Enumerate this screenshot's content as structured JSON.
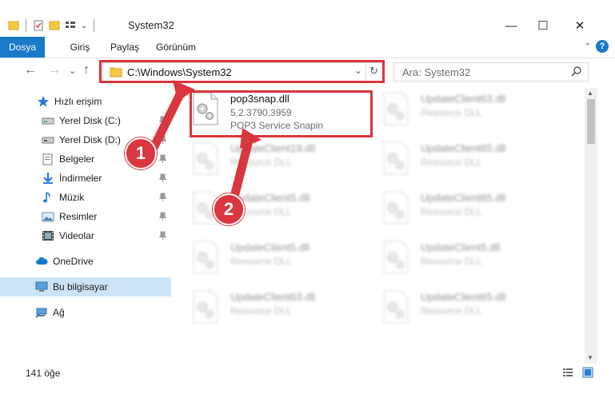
{
  "window": {
    "title": "System32",
    "minimize": "—",
    "maximize": "☐",
    "close": "✕"
  },
  "ribbon": {
    "tabs": [
      "Dosya",
      "Giriş",
      "Paylaş",
      "Görünüm"
    ],
    "collapse": "⌃",
    "help": "?"
  },
  "navigation": {
    "back": "←",
    "forward": "→",
    "recent": "⌄",
    "up": "↑"
  },
  "address": {
    "path": "C:\\Windows\\System32",
    "dropdown": "⌄",
    "refresh": "↻"
  },
  "search": {
    "placeholder": "Ara: System32"
  },
  "sidebar": {
    "items": [
      {
        "label": "Hızlı erişim"
      },
      {
        "label": "Yerel Disk (C:)"
      },
      {
        "label": "Yerel Disk (D:)"
      },
      {
        "label": "Belgeler"
      },
      {
        "label": "İndirmeler"
      },
      {
        "label": "Müzik"
      },
      {
        "label": "Resimler"
      },
      {
        "label": "Videolar"
      },
      {
        "label": "OneDrive"
      },
      {
        "label": "Bu bilgisayar"
      },
      {
        "label": "Ağ"
      }
    ]
  },
  "files": [
    {
      "name": "pop3snap.dll",
      "version": "5.2.3790.3959",
      "description": "POP3 Service Snapin"
    },
    {
      "name": "UpdateClient63.dll",
      "description": "Resource DLL"
    },
    {
      "name": "UpdateClient19.dll",
      "description": "Resource DLL"
    },
    {
      "name": "UpdateClient65.dll",
      "description": "Resource DLL"
    },
    {
      "name": "UpdateClient5.dll",
      "description": "Resource DLL"
    },
    {
      "name": "UpdateClient65.dll",
      "description": "Resource DLL"
    },
    {
      "name": "UpdateClient5.dll",
      "description": "Resource DLL"
    },
    {
      "name": "UpdateClient5.dll",
      "description": "Resource DLL"
    },
    {
      "name": "UpdateClient63.dll",
      "description": "Resource DLL"
    },
    {
      "name": "UpdateClient65.dll",
      "description": "Resource DLL"
    }
  ],
  "status": {
    "count": "141 öğe"
  },
  "annotations": {
    "callout1": "1",
    "callout2": "2",
    "color": "#d9363e"
  },
  "colors": {
    "accent": "#1979ca",
    "selection": "#cce4f7"
  }
}
